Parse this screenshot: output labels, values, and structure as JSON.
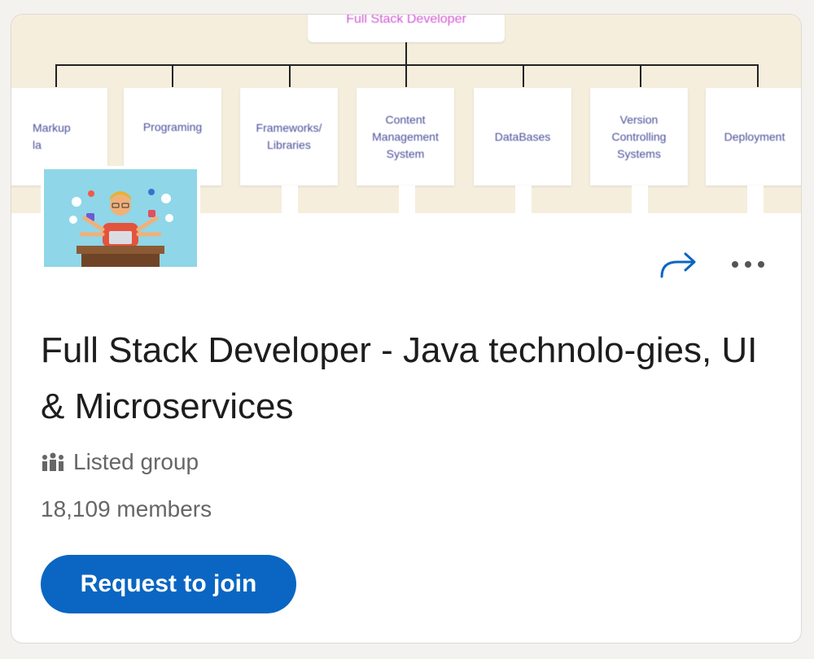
{
  "banner": {
    "root_label": "Full Stack Developer",
    "nodes": [
      {
        "label": "Markup la"
      },
      {
        "label": "Programing"
      },
      {
        "label": "Frameworks/ Libraries"
      },
      {
        "label": "Content Management System"
      },
      {
        "label": "DataBases"
      },
      {
        "label": "Version Controlling Systems"
      },
      {
        "label": "Deployment"
      }
    ],
    "colors": {
      "background": "#f6eedd",
      "root_text": "#d25ad2",
      "node_text": "#4a4f9a"
    }
  },
  "group": {
    "title": "Full Stack Developer - Java technolo-gies, UI & Microservices",
    "privacy_icon": "group-icon",
    "privacy_label": "Listed group",
    "members_label": "18,109 members"
  },
  "actions": {
    "share_icon": "share-arrow-icon",
    "more_icon": "more-options-icon",
    "join_label": "Request to join"
  },
  "colors": {
    "accent": "#0a66c2",
    "page_bg": "#f3f2ef",
    "card_bg": "#ffffff"
  }
}
